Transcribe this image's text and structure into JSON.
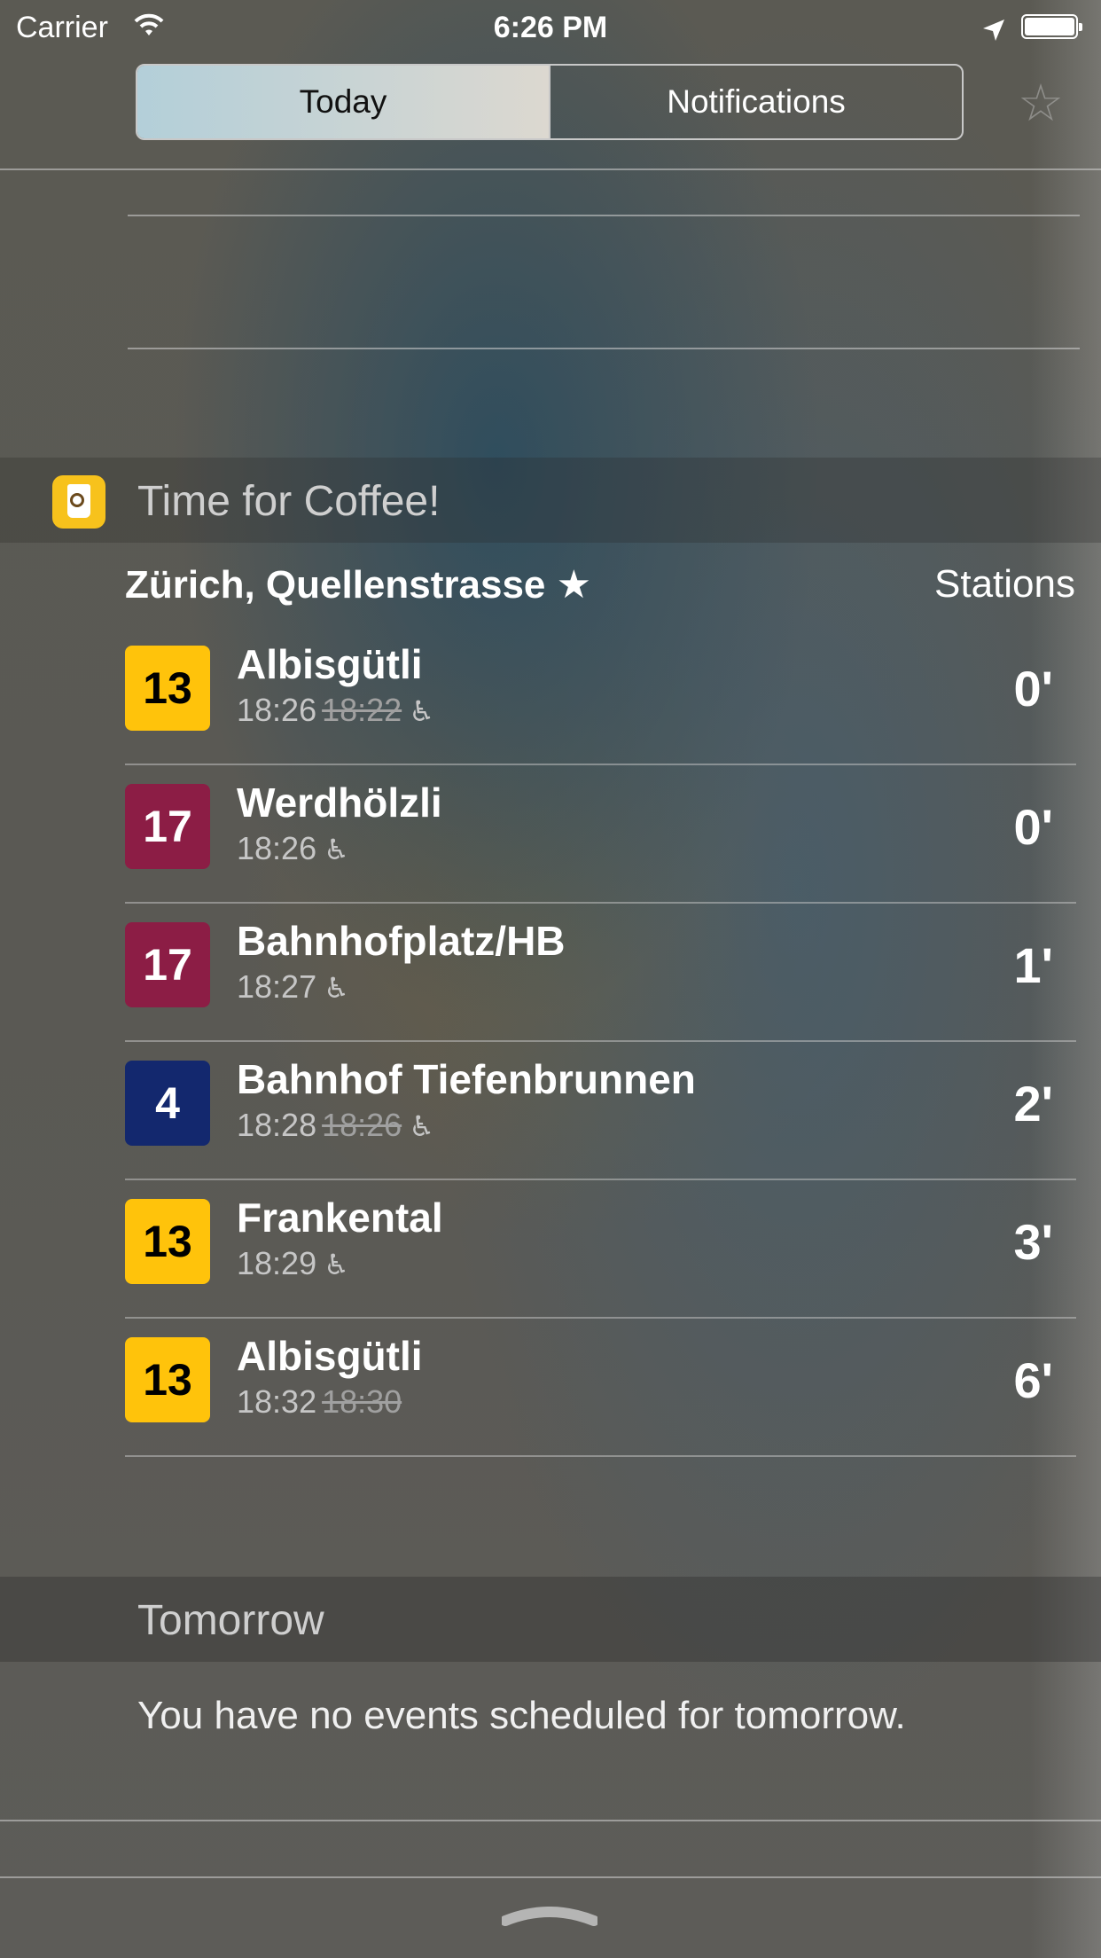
{
  "status_bar": {
    "carrier": "Carrier",
    "time": "6:26 PM"
  },
  "segmented_control": {
    "today_label": "Today",
    "notifications_label": "Notifications"
  },
  "widget": {
    "title": "Time for Coffee!",
    "station": "Zürich, Quellenstrasse ★",
    "stations_link": "Stations",
    "departures": [
      {
        "line": "13",
        "line_color": "#ffc30b",
        "line_text_color": "#000000",
        "destination": "Albisgütli",
        "time": "18:26",
        "scheduled": "18:22",
        "accessible": true,
        "minutes": "0'"
      },
      {
        "line": "17",
        "line_color": "#8c1d45",
        "line_text_color": "#ffffff",
        "destination": "Werdhölzli",
        "time": "18:26",
        "scheduled": "",
        "accessible": true,
        "minutes": "0'"
      },
      {
        "line": "17",
        "line_color": "#8c1d45",
        "line_text_color": "#ffffff",
        "destination": "Bahnhofplatz/HB",
        "time": "18:27",
        "scheduled": "",
        "accessible": true,
        "minutes": "1'"
      },
      {
        "line": "4",
        "line_color": "#13286e",
        "line_text_color": "#ffffff",
        "destination": "Bahnhof Tiefenbrunnen",
        "time": "18:28",
        "scheduled": "18:26",
        "accessible": true,
        "minutes": "2'"
      },
      {
        "line": "13",
        "line_color": "#ffc30b",
        "line_text_color": "#000000",
        "destination": "Frankental",
        "time": "18:29",
        "scheduled": "",
        "accessible": true,
        "minutes": "3'"
      },
      {
        "line": "13",
        "line_color": "#ffc30b",
        "line_text_color": "#000000",
        "destination": "Albisgütli",
        "time": "18:32",
        "scheduled": "18:30",
        "accessible": false,
        "minutes": "6'"
      }
    ]
  },
  "tomorrow": {
    "title": "Tomorrow",
    "message": "You have no events scheduled for tomorrow."
  },
  "icons": {
    "wifi": "wifi-icon",
    "location": "location-arrow-icon",
    "battery": "battery-icon",
    "edit_star": "star-icon",
    "app": "coffee-cup-icon",
    "wheelchair": "wheelchair-icon",
    "grabber": "grabber-icon"
  }
}
